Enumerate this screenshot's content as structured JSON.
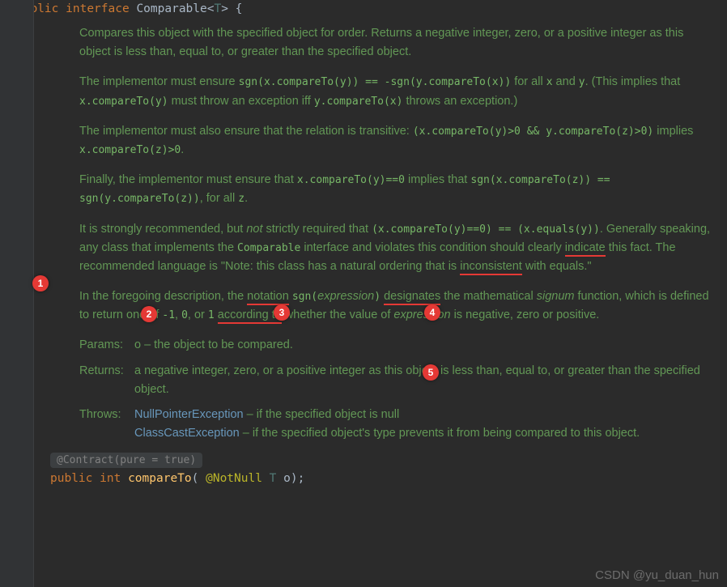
{
  "code": {
    "decl_public": "public",
    "decl_interface": "interface",
    "decl_name": "Comparable",
    "decl_generic_open": "<",
    "decl_generic_t": "T",
    "decl_generic_close": ">",
    "decl_brace": " {",
    "close_brace": "}"
  },
  "doc": {
    "p1": "Compares this object with the specified object for order. Returns a negative integer, zero, or a positive integer as this object is less than, equal to, or greater than the specified object.",
    "p2_a": "The implementor must ensure ",
    "p2_code1": "sgn(x.compareTo(y)) == -sgn(y.compareTo(x))",
    "p2_b": " for all ",
    "p2_code2": "x",
    "p2_c": " and ",
    "p2_code3": "y",
    "p2_d": ". (This implies that ",
    "p2_code4": "x.compareTo(y)",
    "p2_e": " must throw an exception iff ",
    "p2_code5": "y.compareTo(x)",
    "p2_f": " throws an exception.)",
    "p3_a": "The implementor must also ensure that the relation is transitive: ",
    "p3_code1": "(x.compareTo(y)>0 && y.compareTo(z)>0)",
    "p3_b": " implies ",
    "p3_code2": "x.compareTo(z)>0",
    "p3_c": ".",
    "p4_a": "Finally, the implementor must ensure that ",
    "p4_code1": "x.compareTo(y)==0",
    "p4_b": " implies that ",
    "p4_code2": "sgn(x.compareTo(z)) == sgn(y.compareTo(z))",
    "p4_c": ", for all ",
    "p4_code3": "z",
    "p4_d": ".",
    "p5_a": "It is strongly recommended, but ",
    "p5_em": "not",
    "p5_b": " strictly required that ",
    "p5_code1": "(x.compareTo(y)==0) == (x.equals(y))",
    "p5_c": ". Generally speaking, any class that implements the ",
    "p5_code2": "Comparable",
    "p5_d": " interface and violates this condition should clearly ",
    "p5_u1": "indicate",
    "p5_e": " this fact. The recommended language is \"Note: this class has a natural ordering that is ",
    "p5_u2": "inconsistent",
    "p5_f": " with equals.\"",
    "p6_a": "In the foregoing description, the ",
    "p6_u1": "notation",
    "p6_b": " ",
    "p6_code1": "sgn(",
    "p6_em1": "expression",
    "p6_code1b": ")",
    "p6_c": " ",
    "p6_u2": "designates",
    "p6_d": " the mathematical ",
    "p6_em2": "signum",
    "p6_e": " function, which is defined to return one of ",
    "p6_code2": "-1",
    "p6_f": ", ",
    "p6_code3": "0",
    "p6_g": ", or ",
    "p6_code4": "1",
    "p6_h": " ",
    "p6_u3": "according to",
    "p6_i": " whether the value of ",
    "p6_em3": "expression",
    "p6_j": " is negative, zero or positive.",
    "params_label": "Params:",
    "params_text": "o – the object to be compared.",
    "returns_label": "Returns:",
    "returns_text": "a negative integer, zero, or a positive integer as this object is less than, equal to, or greater than the specified object.",
    "throws_label": "Throws:",
    "throws_1_exc": "NullPointerException",
    "throws_1_text": " – if the specified object is null",
    "throws_2_exc": "ClassCastException",
    "throws_2_text": " – if the specified object's type prevents it from being compared to this object."
  },
  "contract": "@Contract(pure = true)",
  "method": {
    "vis": "public",
    "ret": "int",
    "name": "compareTo",
    "open": "( ",
    "ann": "@NotNull",
    "ptype": " T ",
    "pname": "o",
    "close": ");"
  },
  "markers": {
    "m1": "1",
    "m2": "2",
    "m3": "3",
    "m4": "4",
    "m5": "5"
  },
  "watermark": "CSDN @yu_duan_hun"
}
